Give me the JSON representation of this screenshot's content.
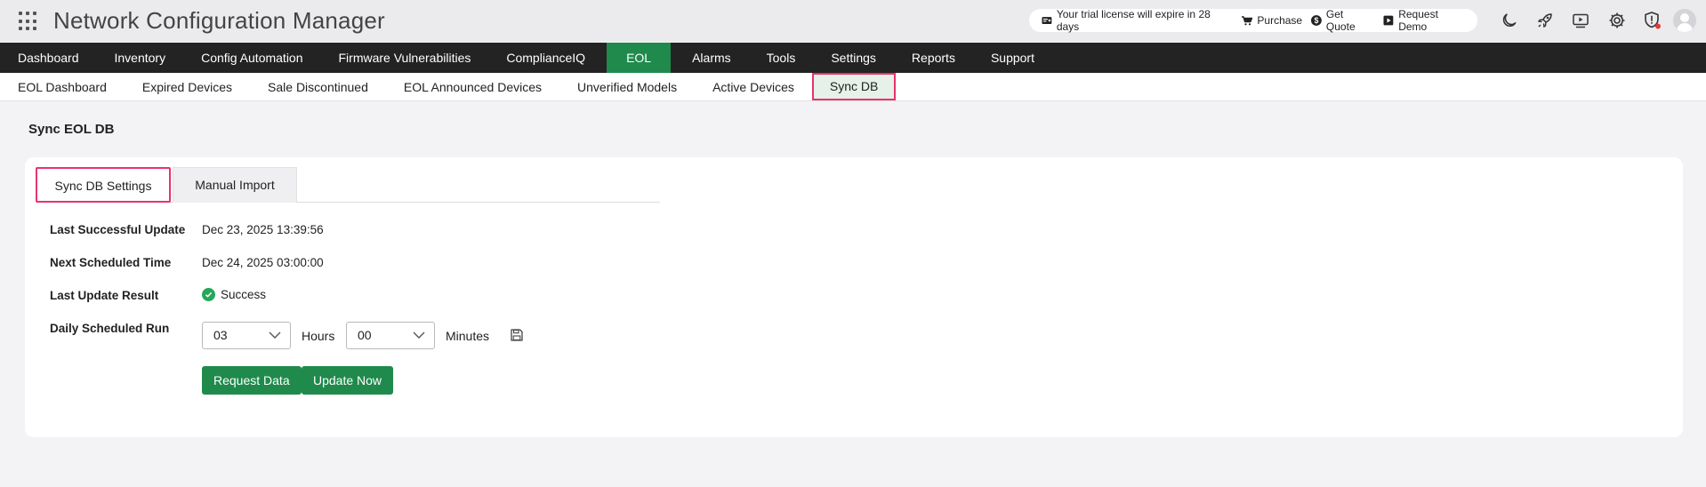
{
  "header": {
    "app_title": "Network Configuration Manager",
    "trial_notice": "Your trial license will expire in 28 days",
    "links": [
      "Purchase",
      "Get Quote",
      "Request Demo"
    ]
  },
  "main_nav": [
    "Dashboard",
    "Inventory",
    "Config Automation",
    "Firmware Vulnerabilities",
    "ComplianceIQ",
    "EOL",
    "Alarms",
    "Tools",
    "Settings",
    "Reports",
    "Support"
  ],
  "main_nav_active": "EOL",
  "sub_nav": [
    "EOL Dashboard",
    "Expired Devices",
    "Sale Discontinued",
    "EOL Announced Devices",
    "Unverified Models",
    "Active Devices",
    "Sync DB"
  ],
  "sub_nav_active": "Sync DB",
  "page_title": "Sync EOL DB",
  "tabs": [
    "Sync DB Settings",
    "Manual Import"
  ],
  "details": {
    "last_successful_update_label": "Last Successful Update",
    "last_successful_update": "Dec 23, 2025 13:39:56",
    "next_scheduled_time_label": "Next Scheduled Time",
    "next_scheduled_time": "Dec 24, 2025 03:00:00",
    "last_update_result_label": "Last Update Result",
    "last_update_result": "Success",
    "daily_scheduled_run_label": "Daily Scheduled Run",
    "hours_value": "03",
    "hours_label": "Hours",
    "minutes_value": "00",
    "minutes_label": "Minutes"
  },
  "buttons": {
    "request_data": "Request Data",
    "update_now": "Update Now"
  },
  "colors": {
    "accent_green": "#1f8a4c",
    "highlight_pink": "#e8336d",
    "nav_dark": "#232323"
  }
}
